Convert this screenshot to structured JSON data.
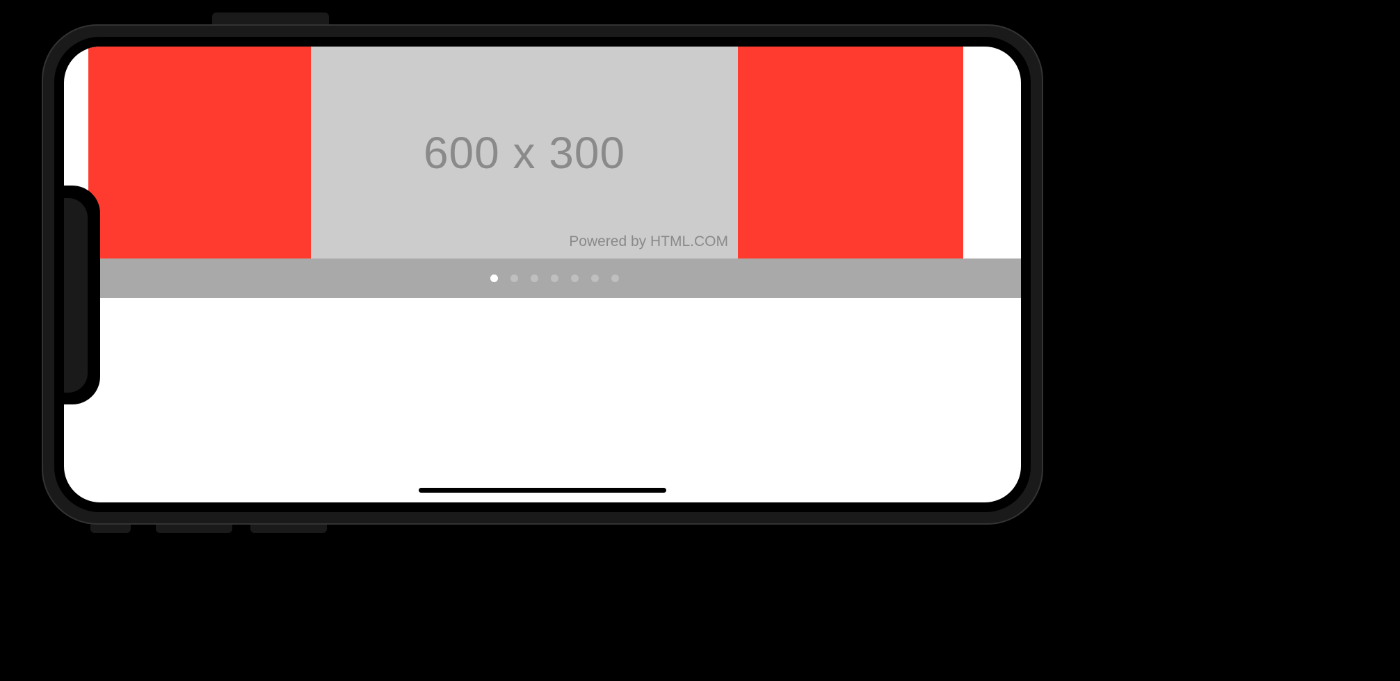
{
  "placeholder": {
    "dimensions_text": "600 x 300",
    "attribution": "Powered by HTML.COM"
  },
  "pagination": {
    "dots_count": 7,
    "active_index": 0
  }
}
